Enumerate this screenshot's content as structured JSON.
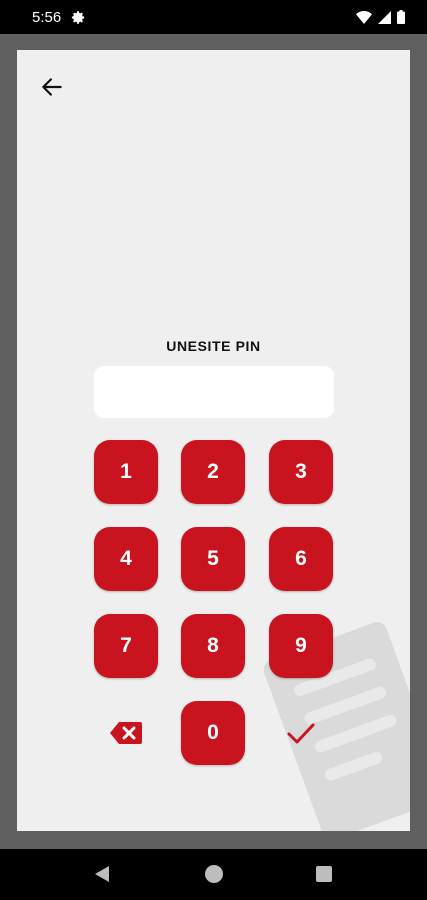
{
  "status_bar": {
    "time": "5:56"
  },
  "pin_entry": {
    "title": "UNESITE PIN",
    "value": ""
  },
  "keypad": {
    "keys": [
      "1",
      "2",
      "3",
      "4",
      "5",
      "6",
      "7",
      "8",
      "9",
      "0"
    ],
    "backspace_icon": "backspace-icon",
    "confirm_icon": "check-icon",
    "key_color": "#c9141f"
  },
  "navigation": {
    "back_icon": "arrow-left-icon"
  }
}
